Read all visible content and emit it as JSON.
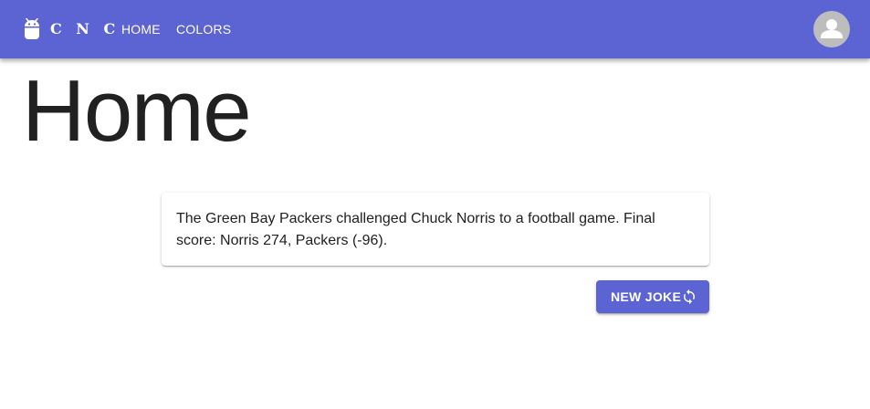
{
  "header": {
    "brand": "C N C",
    "logo_icon": "android-icon",
    "nav": [
      {
        "label": "HOME"
      },
      {
        "label": "COLORS"
      }
    ],
    "avatar_icon": "account-circle-icon"
  },
  "main": {
    "title": "Home",
    "joke": "The Green Bay Packers challenged Chuck Norris to a football game. Final score: Norris 274, Packers (-96).",
    "new_joke_button": {
      "label": "NEW JOKE",
      "icon": "refresh-icon"
    }
  },
  "colors": {
    "primary": "#5c63d3",
    "text": "#212121",
    "avatar_bg": "#bdbdbd"
  }
}
